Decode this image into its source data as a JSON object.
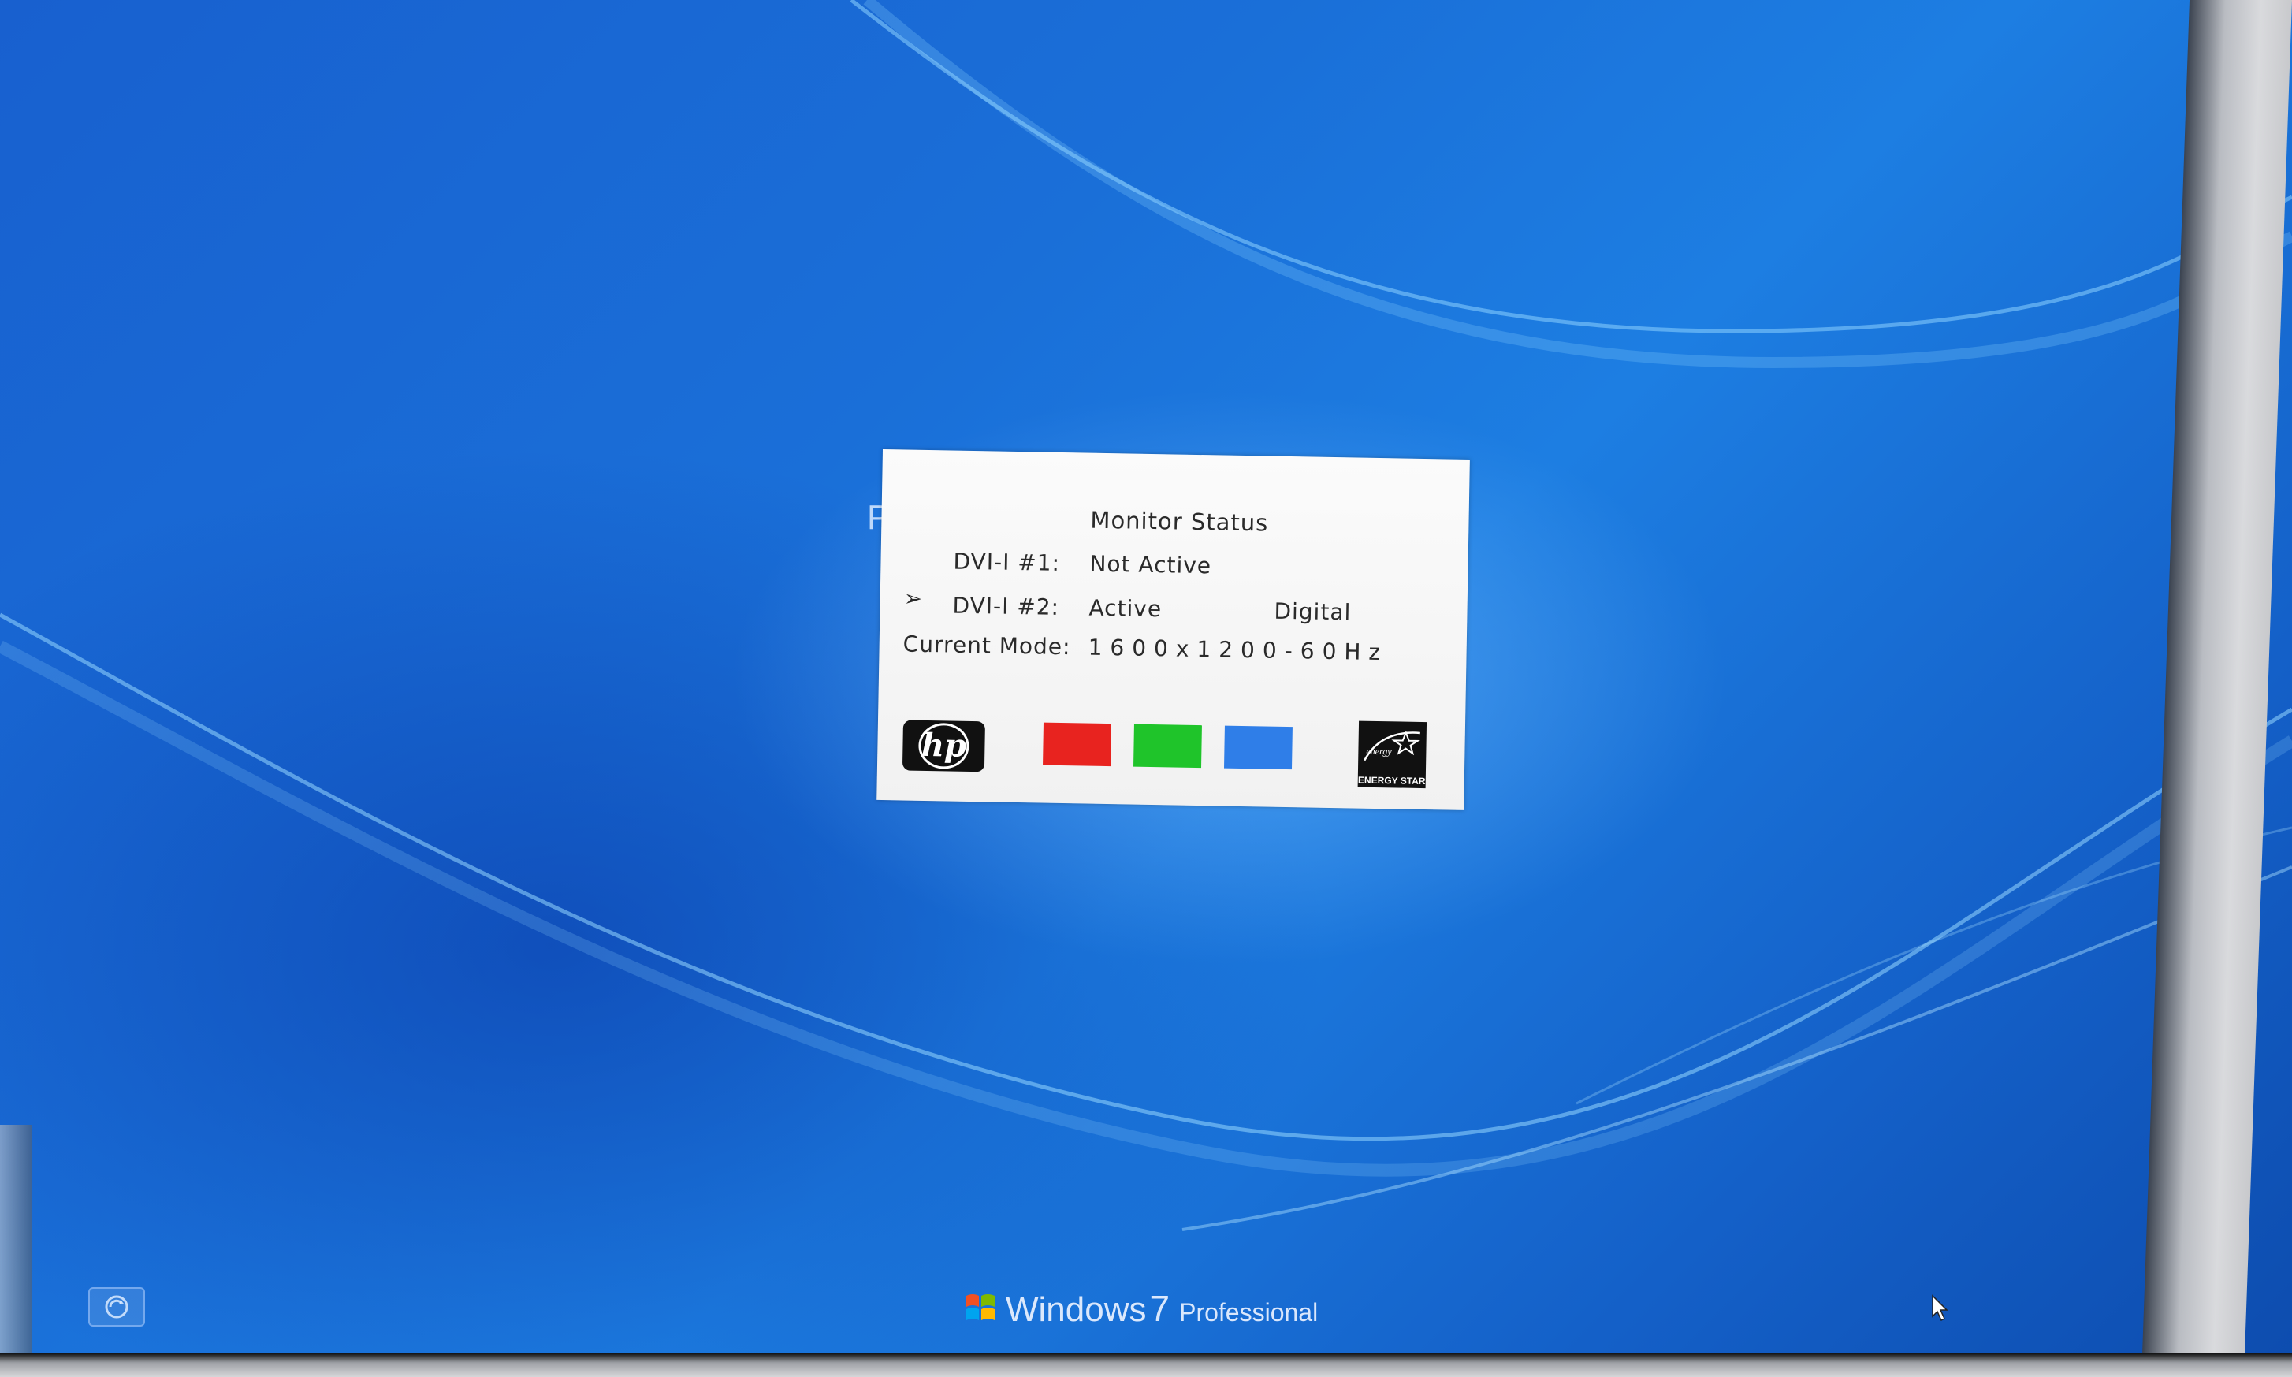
{
  "screen": {
    "background_color": "#1a6fd8",
    "partial_letter": "P"
  },
  "osd": {
    "title": "Monitor Status",
    "rows": [
      {
        "label": "DVI-I #1:",
        "value": "Not Active",
        "selected": false
      },
      {
        "label": "DVI-I #2:",
        "value": "Active",
        "extra": "Digital",
        "selected": true
      },
      {
        "label": "Current Mode:",
        "value": "1600x1200-60Hz"
      }
    ],
    "selection_marker": "➢",
    "color_swatches": [
      "#e8231f",
      "#1fc42a",
      "#2f7ee8"
    ],
    "brand_logo": "hp",
    "certification_logo": "ENERGY STAR"
  },
  "footer": {
    "os_name": "Windows",
    "os_version": "7",
    "os_edition": "Professional",
    "ease_of_access_icon": "ease-of-access-icon"
  }
}
